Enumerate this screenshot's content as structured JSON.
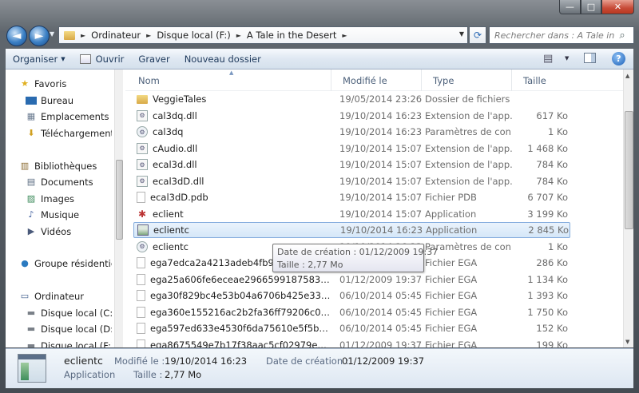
{
  "window": {
    "min_label": "—",
    "max_label": "□",
    "close_label": "✕"
  },
  "nav": {
    "back_label": "◄",
    "forward_label": "►",
    "refresh_label": "⟳",
    "breadcrumbs": [
      "Ordinateur",
      "Disque local (F:)",
      "A Tale in the Desert"
    ],
    "search_placeholder": "Rechercher dans : A Tale in th..."
  },
  "toolbar": {
    "organize": "Organiser",
    "open": "Ouvrir",
    "burn": "Graver",
    "new_folder": "Nouveau dossier",
    "help": "?"
  },
  "navpane": {
    "favorites": "Favoris",
    "desktop": "Bureau",
    "recent_places": "Emplacements réc",
    "downloads": "Téléchargements",
    "libraries": "Bibliothèques",
    "documents": "Documents",
    "images": "Images",
    "music": "Musique",
    "videos": "Vidéos",
    "homegroup": "Groupe résidentiel",
    "computer": "Ordinateur",
    "drive_c": "Disque local (C:)",
    "drive_d": "Disque local (D:)",
    "drive_f": "Disque local (F:)"
  },
  "columns": {
    "name": "Nom",
    "date": "Modifié le",
    "type": "Type",
    "size": "Taille"
  },
  "files": [
    {
      "name": "VeggieTales",
      "date": "19/05/2014 23:26",
      "type": "Dossier de fichiers",
      "size": "",
      "icon": "folder-icon"
    },
    {
      "name": "cal3dq.dll",
      "date": "19/10/2014 16:23",
      "type": "Extension de l'app...",
      "size": "617 Ko",
      "icon": "dll-icon"
    },
    {
      "name": "cal3dq",
      "date": "19/10/2014 16:23",
      "type": "Paramètres de con...",
      "size": "1 Ko",
      "icon": "config-icon"
    },
    {
      "name": "cAudio.dll",
      "date": "19/10/2014 15:07",
      "type": "Extension de l'app...",
      "size": "1 468 Ko",
      "icon": "dll-icon"
    },
    {
      "name": "ecal3d.dll",
      "date": "19/10/2014 15:07",
      "type": "Extension de l'app...",
      "size": "784 Ko",
      "icon": "dll-icon"
    },
    {
      "name": "ecal3dD.dll",
      "date": "19/10/2014 15:07",
      "type": "Extension de l'app...",
      "size": "784 Ko",
      "icon": "dll-icon"
    },
    {
      "name": "ecal3dD.pdb",
      "date": "19/10/2014 15:07",
      "type": "Fichier PDB",
      "size": "6 707 Ko",
      "icon": "document-icon"
    },
    {
      "name": "eclient",
      "date": "19/10/2014 15:07",
      "type": "Application",
      "size": "3 199 Ko",
      "icon": "app-icon"
    },
    {
      "name": "eclientc",
      "date": "19/10/2014 16:23",
      "type": "Application",
      "size": "2 845 Ko",
      "icon": "app-window-icon"
    },
    {
      "name": "eclientc",
      "date": "19/10/2014 16:23",
      "type": "Paramètres de con...",
      "size": "1 Ko",
      "icon": "config-icon"
    },
    {
      "name": "ega7edca2a4213adeb4fb9f8...",
      "date": "01/12/2009 19:37",
      "type": "Fichier EGA",
      "size": "286 Ko",
      "icon": "document-icon"
    },
    {
      "name": "ega25a606fe6eceae29665991875834836...",
      "date": "01/12/2009 19:37",
      "type": "Fichier EGA",
      "size": "1 134 Ko",
      "icon": "document-icon"
    },
    {
      "name": "ega30f829bc4e53b04a6706b425e339c47...",
      "date": "06/10/2014 05:45",
      "type": "Fichier EGA",
      "size": "1 393 Ko",
      "icon": "document-icon"
    },
    {
      "name": "ega360e155216ac2b2fa36ff79206c091e0...",
      "date": "06/10/2014 05:45",
      "type": "Fichier EGA",
      "size": "1 750 Ko",
      "icon": "document-icon"
    },
    {
      "name": "ega597ed633e4530f6da75610e5f5bc8ea...",
      "date": "06/10/2014 05:45",
      "type": "Fichier EGA",
      "size": "152 Ko",
      "icon": "document-icon"
    },
    {
      "name": "ega8675549e7b17f38aac5cf02979ed27c...",
      "date": "01/12/2009 19:37",
      "type": "Fichier EGA",
      "size": "199 Ko",
      "icon": "document-icon"
    }
  ],
  "selected_index": 8,
  "tooltip": {
    "created": "Date de création : 01/12/2009 19:37",
    "size": "Taille : 2,77 Mo"
  },
  "details": {
    "name": "eclientc",
    "type": "Application",
    "modified_label": "Modifié le :",
    "modified_value": "19/10/2014 16:23",
    "created_label": "Date de création :",
    "created_value": "01/12/2009 19:37",
    "size_label": "Taille :",
    "size_value": "2,77 Mo"
  }
}
